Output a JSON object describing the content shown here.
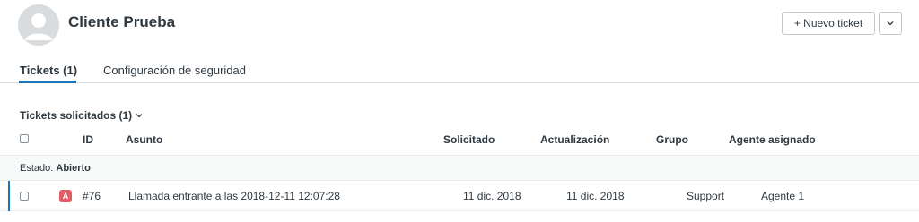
{
  "header": {
    "customer_name": "Cliente Prueba",
    "new_ticket_label": "+ Nuevo ticket",
    "dropdown_icon": "chevron-down-icon"
  },
  "tabs": [
    {
      "label": "Tickets (1)",
      "active": true
    },
    {
      "label": "Configuración de seguridad",
      "active": false
    }
  ],
  "tickets_section": {
    "title": "Tickets solicitados (1)",
    "columns": {
      "id": "ID",
      "subject": "Asunto",
      "requested": "Solicitado",
      "updated": "Actualización",
      "group": "Grupo",
      "assignee": "Agente asignado"
    },
    "group_row": {
      "label": "Estado:",
      "value": "Abierto"
    },
    "rows": [
      {
        "status_letter": "A",
        "status_color": "#e35b66",
        "id": "#76",
        "subject": "Llamada entrante a las 2018-12-11 12:07:28",
        "requested": "11 dic. 2018",
        "updated": "11 dic. 2018",
        "group": "Support",
        "assignee": "Agente 1"
      }
    ]
  },
  "colors": {
    "accent": "#1f73b7",
    "text": "#2f3941",
    "border": "#d8dcde"
  }
}
